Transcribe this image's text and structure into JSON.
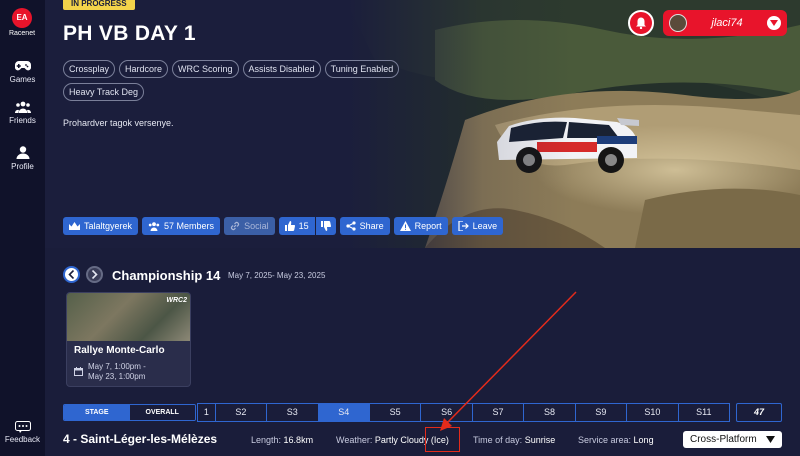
{
  "sidebar": {
    "logo": {
      "badge": "EA",
      "label": "Racenet"
    },
    "items": [
      {
        "label": "Games",
        "icon": "gamepad-icon"
      },
      {
        "label": "Friends",
        "icon": "friends-icon"
      },
      {
        "label": "Profile",
        "icon": "profile-icon"
      }
    ],
    "feedback": {
      "label": "Feedback",
      "icon": "feedback-icon"
    }
  },
  "header": {
    "status": "IN PROGRESS",
    "title": "PH VB DAY 1",
    "tags": [
      "Crossplay",
      "Hardcore",
      "WRC Scoring",
      "Assists Disabled",
      "Tuning Enabled",
      "Heavy Track Deg"
    ],
    "description": "Prohardver tagok versenye.",
    "actions": {
      "owner": "Talaltgyerek",
      "members": "57 Members",
      "social": "Social",
      "likes": "15",
      "share": "Share",
      "report": "Report",
      "leave": "Leave"
    }
  },
  "user": {
    "name": "jlaci74"
  },
  "championship": {
    "title": "Championship 14",
    "dates": "May 7, 2025- May 23, 2025",
    "event": {
      "brand": "WRC2",
      "name": "Rallye Monte-Carlo",
      "start": "May 7, 1:00pm -",
      "end": "May 23, 1:00pm"
    }
  },
  "tabs": {
    "modes": [
      "STAGE",
      "OVERALL"
    ],
    "stages": [
      "1",
      "S2",
      "S3",
      "S4",
      "S5",
      "S6",
      "S7",
      "S8",
      "S9",
      "S10",
      "S11"
    ],
    "active_stage": "S4",
    "wrc_badge": "47"
  },
  "stage_info": {
    "name": "4 - Saint-Léger-les-Mélèzes",
    "length_label": "Length:",
    "length": "16.8km",
    "weather_label": "Weather:",
    "weather": "Partly Cloudy (Ice)",
    "time_label": "Time of day:",
    "time": "Sunrise",
    "service_label": "Service area:",
    "service": "Long",
    "platform": "Cross-Platform"
  },
  "colors": {
    "background": "#1a1d3a",
    "accent": "#2f66d0",
    "brand_red": "#e8142b",
    "status_yellow": "#f3d34a",
    "annotation": "#e32b1b"
  }
}
